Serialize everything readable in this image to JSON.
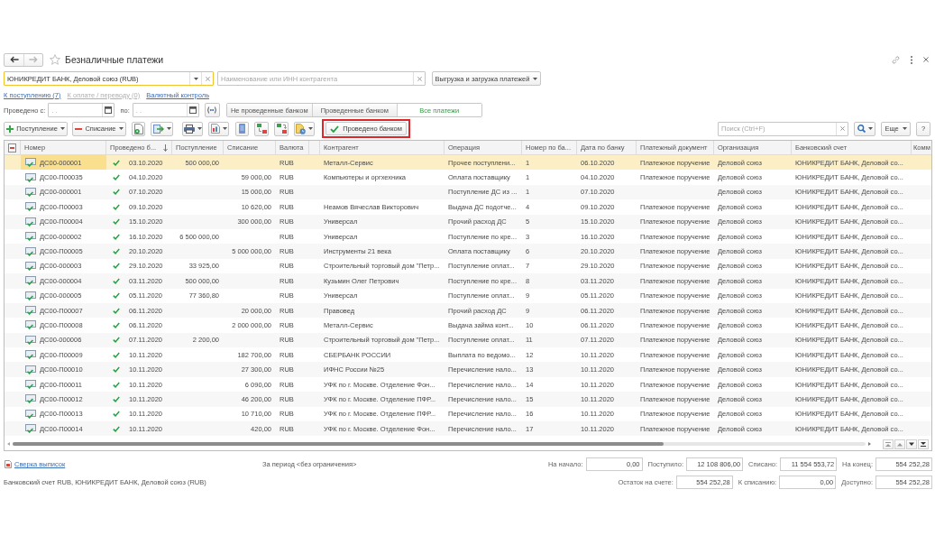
{
  "window": {
    "title": "Безналичные платежи",
    "favorite": false
  },
  "navigation": {
    "back_disabled": false,
    "forward_disabled": true
  },
  "bank_account_field": {
    "value": "ЮНИКРЕДИТ БАНК, Деловой союз (RUB)",
    "focused": true
  },
  "counterparty_field": {
    "placeholder": "Наименование или ИНН контрагента"
  },
  "exchange_button": {
    "label": "Выгрузка и загрузка платежей"
  },
  "quick_links": [
    {
      "label": "К поступлению (7)",
      "disabled": false
    },
    {
      "label": "К оплате / переводу (0)",
      "disabled": true
    },
    {
      "label": "Валютный контроль",
      "disabled": false
    }
  ],
  "period": {
    "from_label": "Проведено с:",
    "from_placeholder": ". .",
    "to_label": "по:",
    "to_placeholder": ". ."
  },
  "payment_filter": [
    {
      "label": "Не проведенные банком",
      "selected": false
    },
    {
      "label": "Проведенные банком",
      "selected": false
    },
    {
      "label": "Все платежи",
      "selected": true
    }
  ],
  "toolbar": {
    "create_buttons": [
      {
        "kind": "income",
        "label": "Поступление",
        "dropdown": true
      },
      {
        "kind": "expense",
        "label": "Списание",
        "dropdown": true
      }
    ],
    "icon_buttons": [
      {
        "kind": "document",
        "dropdown": false
      },
      {
        "kind": "import",
        "dropdown": true
      },
      {
        "kind": "print",
        "dropdown": true
      },
      {
        "kind": "report",
        "dropdown": true
      },
      {
        "kind": "register",
        "dropdown": false
      },
      {
        "kind": "postings",
        "dropdown": false
      },
      {
        "kind": "accounts",
        "dropdown": false
      },
      {
        "kind": "history",
        "dropdown": true
      }
    ],
    "confirm_button": {
      "label": "Проведено банком",
      "highlighted": true
    },
    "search": {
      "placeholder": "Поиск (Ctrl+F)"
    },
    "more_button": {
      "label": "Еще"
    },
    "help_button": {
      "label": "?"
    }
  },
  "table": {
    "columns": [
      {
        "kind": "mark"
      },
      {
        "kind": "document",
        "label": "Номер",
        "sorted": false
      },
      {
        "kind": "date",
        "label": "Проведено б...",
        "sorted": true
      },
      {
        "kind": "amount",
        "label": "Поступление",
        "sorted": false
      },
      {
        "kind": "amount",
        "label": "Списание",
        "sorted": false
      },
      {
        "kind": "text",
        "label": "Валюта",
        "sorted": false
      },
      {
        "kind": "text"
      },
      {
        "kind": "text",
        "label": "Контрагент",
        "sorted": false
      },
      {
        "kind": "text",
        "label": "Операция",
        "sorted": false
      },
      {
        "kind": "text",
        "label": "Номер по ба...",
        "sorted": false
      },
      {
        "kind": "text",
        "label": "Дата по банку",
        "sorted": false
      },
      {
        "kind": "text",
        "label": "Платежный документ",
        "sorted": false
      },
      {
        "kind": "text",
        "label": "Организация",
        "sorted": false
      },
      {
        "kind": "text",
        "label": "Банковский счет",
        "sorted": false
      },
      {
        "kind": "text",
        "label": "Комм",
        "sorted": false
      }
    ],
    "rows": [
      {
        "selected": true,
        "confirmed": true,
        "number": "ДС00-000001",
        "date": "03.10.2020",
        "income": "500 000,00",
        "currency": "RUB",
        "counterparty": "Металл-Сервис",
        "operation": "Прочее поступлени...",
        "bank_number": "1",
        "bank_date": "06.10.2020",
        "payment_document": "Платежное поручение",
        "organization": "Деловой союз",
        "bank_account": "ЮНИКРЕДИТ БАНК, Деловой со..."
      },
      {
        "selected": false,
        "confirmed": true,
        "number": "ДС00-П00035",
        "date": "04.10.2020",
        "expense": "59 000,00",
        "currency": "RUB",
        "counterparty": "Компьютеры и оргхехника",
        "operation": "Оплата поставщику",
        "bank_number": "1",
        "bank_date": "04.10.2020",
        "payment_document": "Платежное поручение",
        "organization": "Деловой союз",
        "bank_account": "ЮНИКРЕДИТ БАНК, Деловой со..."
      },
      {
        "selected": false,
        "confirmed": true,
        "number": "ДС00-000001",
        "date": "07.10.2020",
        "expense": "15 000,00",
        "currency": "RUB",
        "operation": "Поступление ДС из ...",
        "bank_number": "1",
        "bank_date": "07.10.2020",
        "organization": "Деловой союз",
        "bank_account": "ЮНИКРЕДИТ БАНК, Деловой со..."
      },
      {
        "selected": false,
        "confirmed": true,
        "number": "ДС00-П00003",
        "date": "09.10.2020",
        "expense": "10 620,00",
        "currency": "RUB",
        "counterparty": "Неамов Вячеслав Викторович",
        "operation": "Выдача ДС подотче...",
        "bank_number": "4",
        "bank_date": "09.10.2020",
        "payment_document": "Платежное поручение",
        "organization": "Деловой союз",
        "bank_account": "ЮНИКРЕДИТ БАНК, Деловой со..."
      },
      {
        "selected": false,
        "confirmed": true,
        "number": "ДС00-П00004",
        "date": "15.10.2020",
        "expense": "300 000,00",
        "currency": "RUB",
        "counterparty": "Универсал",
        "operation": "Прочий расход ДС",
        "bank_number": "5",
        "bank_date": "15.10.2020",
        "payment_document": "Платежное поручение",
        "organization": "Деловой союз",
        "bank_account": "ЮНИКРЕДИТ БАНК, Деловой со..."
      },
      {
        "selected": false,
        "confirmed": true,
        "number": "ДС00-000002",
        "date": "16.10.2020",
        "income": "6 500 000,00",
        "currency": "RUB",
        "counterparty": "Универсал",
        "operation": "Поступление по кре...",
        "bank_number": "3",
        "bank_date": "16.10.2020",
        "payment_document": "Платежное поручение",
        "organization": "Деловой союз",
        "bank_account": "ЮНИКРЕДИТ БАНК, Деловой со..."
      },
      {
        "selected": false,
        "confirmed": true,
        "number": "ДС00-П00005",
        "date": "20.10.2020",
        "expense": "5 000 000,00",
        "currency": "RUB",
        "counterparty": "Инструменты 21 века",
        "operation": "Оплата поставщику",
        "bank_number": "6",
        "bank_date": "20.10.2020",
        "payment_document": "Платежное поручение",
        "organization": "Деловой союз",
        "bank_account": "ЮНИКРЕДИТ БАНК, Деловой со..."
      },
      {
        "selected": false,
        "confirmed": true,
        "number": "ДС00-000003",
        "date": "29.10.2020",
        "income": "33 925,00",
        "currency": "RUB",
        "counterparty": "Строительный торговый дом \"Петр...",
        "operation": "Поступление оплат...",
        "bank_number": "7",
        "bank_date": "29.10.2020",
        "payment_document": "Платежное поручение",
        "organization": "Деловой союз",
        "bank_account": "ЮНИКРЕДИТ БАНК, Деловой со..."
      },
      {
        "selected": false,
        "confirmed": true,
        "number": "ДС00-000004",
        "date": "03.11.2020",
        "income": "500 000,00",
        "currency": "RUB",
        "counterparty": "Кузьмин Олег Петрович",
        "operation": "Поступление по кре...",
        "bank_number": "8",
        "bank_date": "03.11.2020",
        "payment_document": "Платежное поручение",
        "organization": "Деловой союз",
        "bank_account": "ЮНИКРЕДИТ БАНК, Деловой со..."
      },
      {
        "selected": false,
        "confirmed": true,
        "number": "ДС00-000005",
        "date": "05.11.2020",
        "income": "77 360,80",
        "currency": "RUB",
        "counterparty": "Универсал",
        "operation": "Поступление оплат...",
        "bank_number": "9",
        "bank_date": "05.11.2020",
        "payment_document": "Платежное поручение",
        "organization": "Деловой союз",
        "bank_account": "ЮНИКРЕДИТ БАНК, Деловой со..."
      },
      {
        "selected": false,
        "confirmed": true,
        "number": "ДС00-П00007",
        "date": "06.11.2020",
        "expense": "20 000,00",
        "currency": "RUB",
        "counterparty": "Правовед",
        "operation": "Прочий расход ДС",
        "bank_number": "9",
        "bank_date": "06.11.2020",
        "payment_document": "Платежное поручение",
        "organization": "Деловой союз",
        "bank_account": "ЮНИКРЕДИТ БАНК, Деловой со..."
      },
      {
        "selected": false,
        "confirmed": true,
        "number": "ДС00-П00008",
        "date": "06.11.2020",
        "expense": "2 000 000,00",
        "currency": "RUB",
        "counterparty": "Металл-Сервис",
        "operation": "Выдача займа конт...",
        "bank_number": "10",
        "bank_date": "06.11.2020",
        "payment_document": "Платежное поручение",
        "organization": "Деловой союз",
        "bank_account": "ЮНИКРЕДИТ БАНК, Деловой со..."
      },
      {
        "selected": false,
        "confirmed": true,
        "number": "ДС00-000006",
        "date": "07.11.2020",
        "income": "2 200,00",
        "currency": "RUB",
        "counterparty": "Строительный торговый дом \"Петр...",
        "operation": "Поступление оплат...",
        "bank_number": "11",
        "bank_date": "07.11.2020",
        "payment_document": "Платежное поручение",
        "organization": "Деловой союз",
        "bank_account": "ЮНИКРЕДИТ БАНК, Деловой со..."
      },
      {
        "selected": false,
        "confirmed": true,
        "number": "ДС00-П00009",
        "date": "10.11.2020",
        "expense": "182 700,00",
        "currency": "RUB",
        "counterparty": "СБЕРБАНК РОССИИ",
        "operation": "Выплата по ведомо...",
        "bank_number": "12",
        "bank_date": "10.11.2020",
        "payment_document": "Платежное поручение",
        "organization": "Деловой союз",
        "bank_account": "ЮНИКРЕДИТ БАНК, Деловой со..."
      },
      {
        "selected": false,
        "confirmed": true,
        "number": "ДС00-П00010",
        "date": "10.11.2020",
        "expense": "27 300,00",
        "currency": "RUB",
        "counterparty": "ИФНС России №25",
        "operation": "Перечисление нало...",
        "bank_number": "13",
        "bank_date": "10.11.2020",
        "payment_document": "Платежное поручение",
        "organization": "Деловой союз",
        "bank_account": "ЮНИКРЕДИТ БАНК, Деловой со..."
      },
      {
        "selected": false,
        "confirmed": true,
        "number": "ДС00-П00011",
        "date": "10.11.2020",
        "expense": "6 090,00",
        "currency": "RUB",
        "counterparty": "УФК по г. Москве. Отделение Фон...",
        "operation": "Перечисление нало...",
        "bank_number": "14",
        "bank_date": "10.11.2020",
        "payment_document": "Платежное поручение",
        "organization": "Деловой союз",
        "bank_account": "ЮНИКРЕДИТ БАНК, Деловой со..."
      },
      {
        "selected": false,
        "confirmed": true,
        "number": "ДС00-П00012",
        "date": "10.11.2020",
        "expense": "46 200,00",
        "currency": "RUB",
        "counterparty": "УФК по г. Москве. Отделение ПФР...",
        "operation": "Перечисление нало...",
        "bank_number": "15",
        "bank_date": "10.11.2020",
        "payment_document": "Платежное поручение",
        "organization": "Деловой союз",
        "bank_account": "ЮНИКРЕДИТ БАНК, Деловой со..."
      },
      {
        "selected": false,
        "confirmed": true,
        "number": "ДС00-П00013",
        "date": "10.11.2020",
        "expense": "10 710,00",
        "currency": "RUB",
        "counterparty": "УФК по г. Москве. Отделение ПФР...",
        "operation": "Перечисление нало...",
        "bank_number": "16",
        "bank_date": "10.11.2020",
        "payment_document": "Платежное поручение",
        "organization": "Деловой союз",
        "bank_account": "ЮНИКРЕДИТ БАНК, Деловой со..."
      },
      {
        "selected": false,
        "confirmed": true,
        "number": "ДС00-П00014",
        "date": "10.11.2020",
        "expense": "420,00",
        "currency": "RUB",
        "counterparty": "УФК по г. Москве. Отделение Фон...",
        "operation": "Перечисление нало...",
        "bank_number": "17",
        "bank_date": "10.11.2020",
        "payment_document": "Платежное поручение",
        "organization": "Деловой союз",
        "bank_account": "ЮНИКРЕДИТ БАНК, Деловой со..."
      }
    ]
  },
  "footer": {
    "reconcile_link": "Сверка выписок",
    "period_text": "За период <без ограничения>",
    "account_text": "Банковский счет RUB, ЮНИКРЕДИТ БАНК, Деловой союз (RUB)",
    "summary_top": [
      {
        "label": "На начало:",
        "value": "0,00"
      },
      {
        "label": "Поступило:",
        "value": "12 108 806,00"
      },
      {
        "label": "Списано:",
        "value": "11 554 553,72"
      },
      {
        "label": "На конец:",
        "value": "554 252,28"
      }
    ],
    "summary_bottom": [
      {
        "label": "Остаток на счете:",
        "value": "554 252,28"
      },
      {
        "label": "К списанию:",
        "value": "0,00"
      },
      {
        "label": "Доступно:",
        "value": "554 252,28"
      }
    ]
  }
}
